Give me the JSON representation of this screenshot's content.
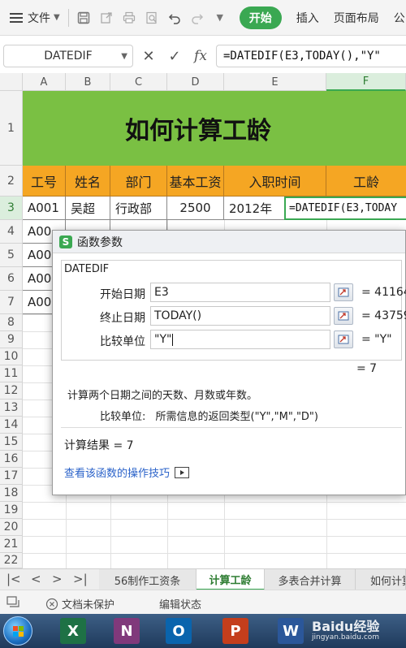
{
  "toolbar": {
    "file_menu": "文件",
    "tabs": [
      "开始",
      "插入",
      "页面布局",
      "公"
    ]
  },
  "formula_bar": {
    "name_box": "DATEDIF",
    "fx": "fx",
    "formula": "=DATEDIF(E3,TODAY(),\"Y\""
  },
  "grid": {
    "columns": [
      "A",
      "B",
      "C",
      "D",
      "E",
      "F"
    ],
    "rows": [
      "1",
      "2",
      "3",
      "4",
      "5",
      "6",
      "7",
      "8",
      "9",
      "10",
      "11",
      "12",
      "13",
      "14",
      "15",
      "16",
      "17",
      "18",
      "19",
      "20",
      "21",
      "22"
    ],
    "title": "如何计算工龄",
    "headers": [
      "工号",
      "姓名",
      "部门",
      "基本工资",
      "入职时间",
      "工龄"
    ],
    "row3": [
      "A001",
      "吴超",
      "行政部",
      "2500",
      "2012年"
    ],
    "formula_cell": "=DATEDIF(E3,TODAY",
    "partial_ids": [
      "A00",
      "A00",
      "A00",
      "A00"
    ]
  },
  "dialog": {
    "title": "函数参数",
    "function_name": "DATEDIF",
    "args": [
      {
        "label": "开始日期",
        "value": "E3",
        "result": "= 41164"
      },
      {
        "label": "终止日期",
        "value": "TODAY()",
        "result": "= 43759"
      },
      {
        "label": "比较单位",
        "value": "\"Y\"",
        "result": "= \"Y\""
      }
    ],
    "total": "= 7",
    "description": "计算两个日期之间的天数、月数或年数。",
    "arg_desc_label": "比较单位:",
    "arg_desc_text": "所需信息的返回类型(\"Y\",\"M\",\"D\")",
    "result_text": "计算结果 = 7",
    "help_link": "查看该函数的操作技巧"
  },
  "sheets": {
    "tabs": [
      "56制作工资条",
      "计算工龄",
      "多表合并计算",
      "如何计算"
    ],
    "active": "计算工龄"
  },
  "status": {
    "protect": "文档未保护",
    "edit_state": "编辑状态"
  },
  "taskbar": {
    "apps": [
      {
        "letter": "X",
        "color": "#1e7145"
      },
      {
        "letter": "N",
        "color": "#80397b"
      },
      {
        "letter": "O",
        "color": "#0a64ad"
      },
      {
        "letter": "P",
        "color": "#c43e1c"
      },
      {
        "letter": "W",
        "color": "#2b579a"
      }
    ],
    "watermark": "Baidu经验",
    "watermark_sub": "jingyan.baidu.com"
  }
}
